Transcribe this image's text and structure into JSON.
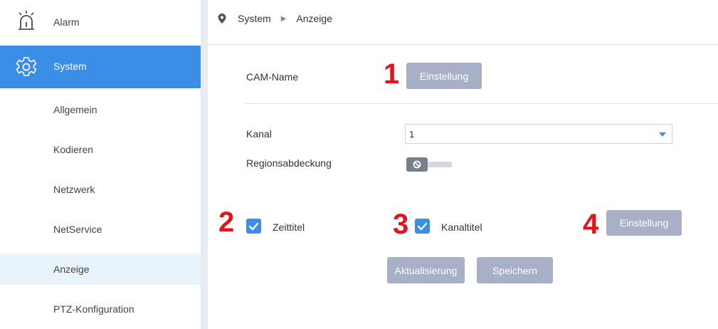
{
  "sidebar": {
    "items": [
      {
        "label": "Alarm"
      },
      {
        "label": "System"
      },
      {
        "label": "Allgemein"
      },
      {
        "label": "Kodieren"
      },
      {
        "label": "Netzwerk"
      },
      {
        "label": "NetService"
      },
      {
        "label": "Anzeige"
      },
      {
        "label": "PTZ-Konfiguration"
      }
    ]
  },
  "breadcrumb": {
    "root": "System",
    "current": "Anzeige"
  },
  "main": {
    "cam_name_label": "CAM-Name",
    "cam_name_button": "Einstellung",
    "kanal_label": "Kanal",
    "kanal_value": "1",
    "regionsabdeckung_label": "Regionsabdeckung",
    "regionsabdeckung_enabled": false,
    "zeittitel_label": "Zeittitel",
    "zeittitel_checked": true,
    "kanaltitel_label": "Kanaltitel",
    "kanaltitel_checked": true,
    "kanaltitel_button": "Einstellung",
    "refresh_button": "Aktualisierung",
    "save_button": "Speichern"
  },
  "annotations": {
    "n1": "1",
    "n2": "2",
    "n3": "3",
    "n4": "4"
  },
  "colors": {
    "accent": "#3a8ee6",
    "button": "#a8b0c8",
    "annotation": "#e1141b"
  }
}
